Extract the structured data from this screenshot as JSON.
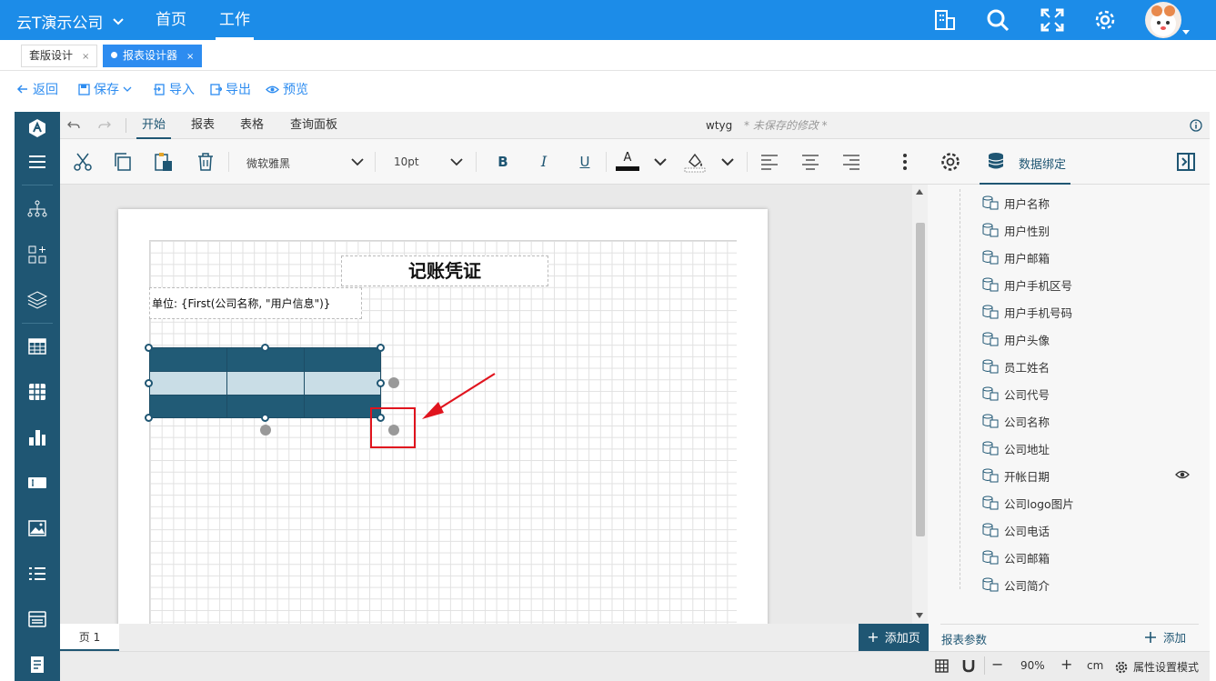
{
  "appbar": {
    "company": "云T演示公司",
    "nav": [
      {
        "label": "首页"
      },
      {
        "label": "工作"
      }
    ]
  },
  "tabs": [
    {
      "label": "套版设计",
      "close": "×"
    },
    {
      "label": "报表设计器",
      "close": "×"
    }
  ],
  "actions": {
    "back": "返回",
    "save": "保存",
    "import": "导入",
    "export": "导出",
    "preview": "预览"
  },
  "menu": {
    "items": [
      "开始",
      "报表",
      "表格",
      "查询面板"
    ],
    "doc_name": "wtyg",
    "unsaved": "* 未保存的修改 *"
  },
  "ribbon": {
    "font_family": "微软雅黑",
    "font_size": "10pt",
    "bold": "B",
    "italic": "I",
    "underline": "U",
    "font_color_glyph": "A",
    "data_binding": "数据绑定"
  },
  "report": {
    "title": "记账凭证",
    "unit": "单位: {First(公司名称, \"用户信息\")}"
  },
  "fields": [
    "用户名称",
    "用户性别",
    "用户邮箱",
    "用户手机区号",
    "用户手机号码",
    "用户头像",
    "员工姓名",
    "公司代号",
    "公司名称",
    "公司地址",
    "开帐日期",
    "公司logo图片",
    "公司电话",
    "公司邮箱",
    "公司简介"
  ],
  "params": {
    "label": "报表参数",
    "add": "添加"
  },
  "pages": {
    "tab": "页 1",
    "add": "添加页"
  },
  "status": {
    "zoom": "90%",
    "unit": "cm",
    "mode": "属性设置模式",
    "minus": "−",
    "plus": "+"
  },
  "colors": {
    "brand": "#1c8ce8",
    "sidebar": "#1f5673",
    "table_dark": "#215b76",
    "table_light": "#c9dde6",
    "highlight": "#e0141e"
  }
}
